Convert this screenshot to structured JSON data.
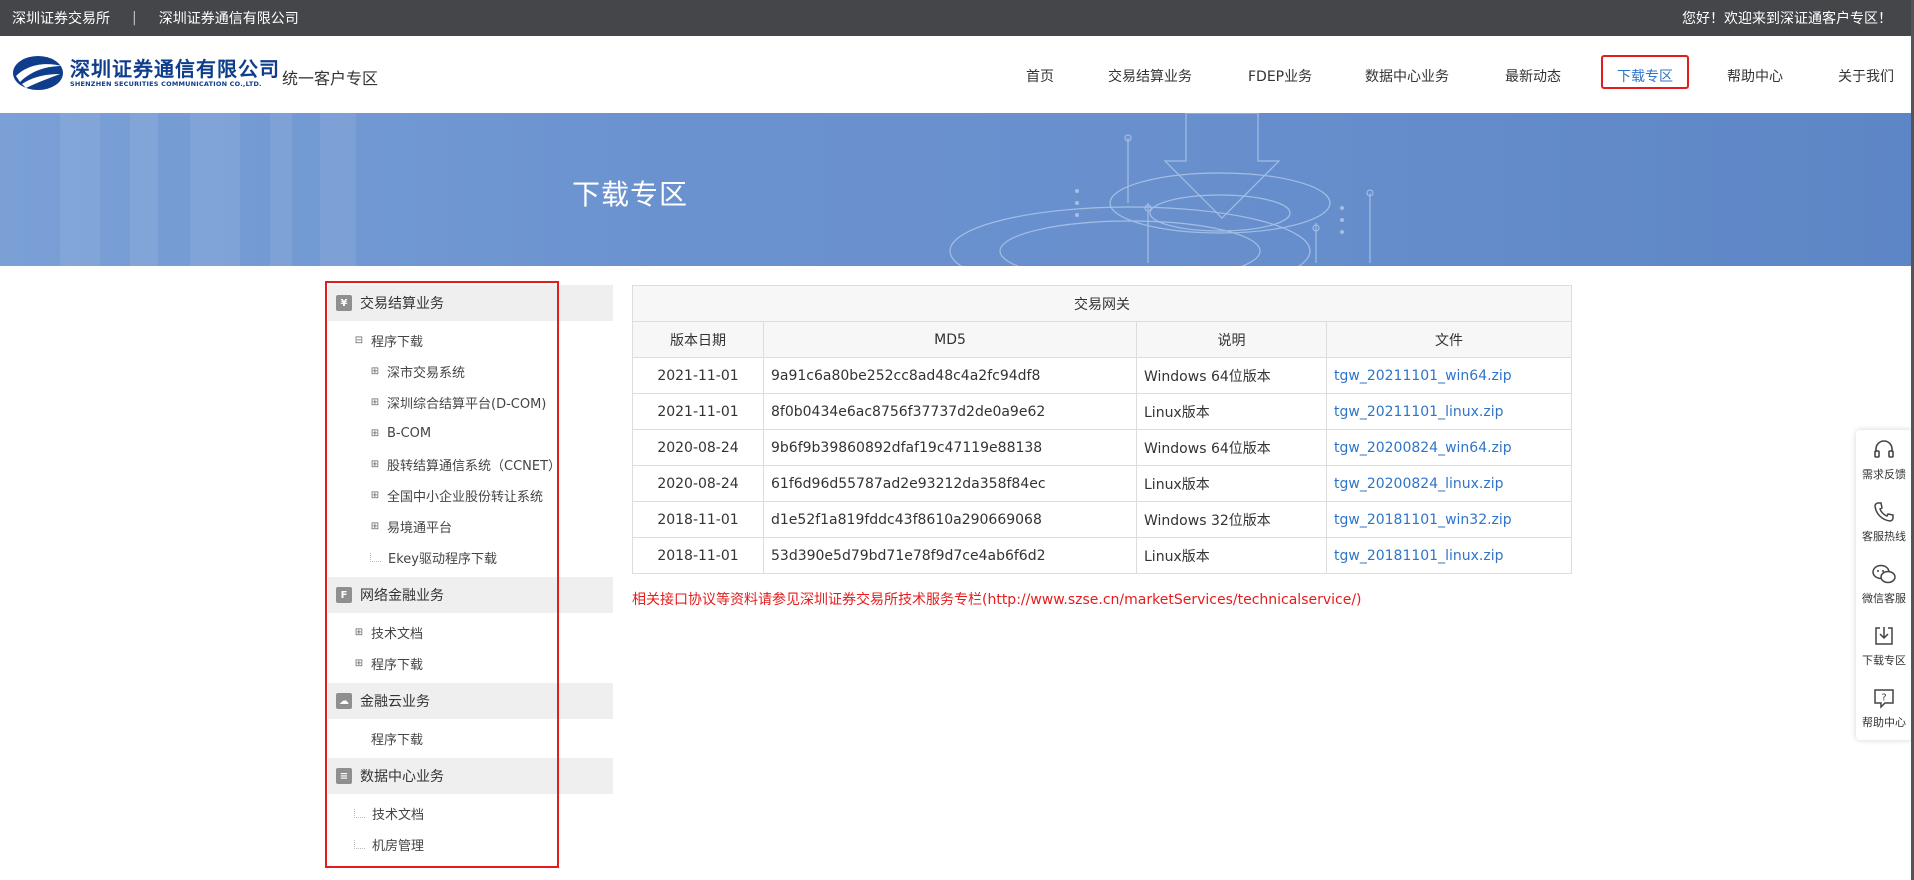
{
  "topbar": {
    "left_links": [
      "深圳证券交易所",
      "深圳证券通信有限公司"
    ],
    "separator": "|",
    "greeting": "您好！欢迎来到深证通客户专区！"
  },
  "header": {
    "logo_cn": "深圳证券通信有限公司",
    "logo_en": "SHENZHEN SECURITIES COMMUNICATION CO.,LTD.",
    "subtitle": "统一客户专区",
    "nav": [
      "首页",
      "交易结算业务",
      "FDEP业务",
      "数据中心业务",
      "最新动态",
      "下载专区",
      "帮助中心",
      "关于我们"
    ],
    "active_nav": "下载专区"
  },
  "banner": {
    "title": "下载专区"
  },
  "sidebar": {
    "sections": [
      {
        "title": "交易结算业务",
        "icon": "trade-icon",
        "items": [
          {
            "label": "程序下载",
            "toggle": "⊟"
          },
          {
            "label": "深市交易系统",
            "toggle": "⊞"
          },
          {
            "label": "深圳综合结算平台(D-COM)",
            "toggle": "⊞"
          },
          {
            "label": "B-COM",
            "toggle": "⊞"
          },
          {
            "label": "股转结算通信系统（CCNET）",
            "toggle": "⊞"
          },
          {
            "label": "全国中小企业股份转让系统",
            "toggle": "⊞"
          },
          {
            "label": "易境通平台",
            "toggle": "⊞"
          },
          {
            "label": "Ekey驱动程序下载",
            "toggle": ""
          }
        ]
      },
      {
        "title": "网络金融业务",
        "icon": "finance-icon",
        "items": [
          {
            "label": "技术文档",
            "toggle": "⊞"
          },
          {
            "label": "程序下载",
            "toggle": "⊞"
          }
        ]
      },
      {
        "title": "金融云业务",
        "icon": "cloud-icon",
        "items": [
          {
            "label": "程序下载",
            "toggle": ""
          }
        ]
      },
      {
        "title": "数据中心业务",
        "icon": "datacenter-icon",
        "items": [
          {
            "label": "技术文档",
            "toggle": ""
          },
          {
            "label": "机房管理",
            "toggle": ""
          }
        ]
      }
    ]
  },
  "table": {
    "caption": "交易网关",
    "headers": [
      "版本日期",
      "MD5",
      "说明",
      "文件"
    ],
    "rows": [
      {
        "date": "2021-11-01",
        "md5": "9a91c6a80be252cc8ad48c4a2fc94df8",
        "desc": "Windows 64位版本",
        "file": "tgw_20211101_win64.zip"
      },
      {
        "date": "2021-11-01",
        "md5": "8f0b0434e6ac8756f37737d2de0a9e62",
        "desc": "Linux版本",
        "file": "tgw_20211101_linux.zip"
      },
      {
        "date": "2020-08-24",
        "md5": "9b6f9b39860892dfaf19c47119e88138",
        "desc": "Windows 64位版本",
        "file": "tgw_20200824_win64.zip"
      },
      {
        "date": "2020-08-24",
        "md5": "61f6d96d55787ad2e93212da358f84ec",
        "desc": "Linux版本",
        "file": "tgw_20200824_linux.zip"
      },
      {
        "date": "2018-11-01",
        "md5": "d1e52f1a819fddc43f8610a290669068",
        "desc": "Windows 32位版本",
        "file": "tgw_20181101_win32.zip"
      },
      {
        "date": "2018-11-01",
        "md5": "53d390e5d79bd71e78f9d7ce4ab6f6d2",
        "desc": "Linux版本",
        "file": "tgw_20181101_linux.zip"
      }
    ],
    "note": "相关接口协议等资料请参见深圳证券交易所技术服务专栏(http://www.szse.cn/marketServices/technicalservice/)"
  },
  "floatbar": [
    {
      "label": "需求反馈",
      "icon": "headset-icon"
    },
    {
      "label": "客服热线",
      "icon": "phone-icon"
    },
    {
      "label": "微信客服",
      "icon": "wechat-icon"
    },
    {
      "label": "下载专区",
      "icon": "download-icon"
    },
    {
      "label": "帮助中心",
      "icon": "help-icon"
    }
  ],
  "colors": {
    "accent": "#2f75c7",
    "highlight": "#e51c1c",
    "topbar": "#444649",
    "banner": "#6990cd"
  }
}
